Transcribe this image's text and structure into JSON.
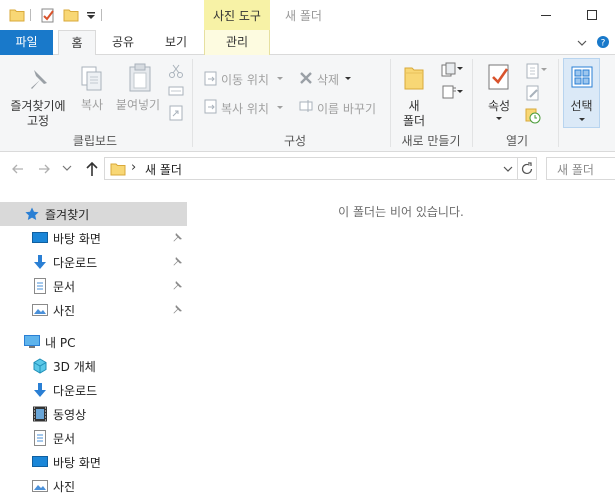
{
  "window": {
    "title": "새 폴더",
    "context_tab_group": "사진 도구"
  },
  "tabs": [
    {
      "label": "파일",
      "active": false
    },
    {
      "label": "홈",
      "active": true
    },
    {
      "label": "공유",
      "active": false
    },
    {
      "label": "보기",
      "active": false
    },
    {
      "label": "관리",
      "active": false
    }
  ],
  "ribbon": {
    "clipboard": {
      "group_label": "클립보드",
      "pin_label_line1": "즐겨찾기에",
      "pin_label_line2": "고정",
      "copy_label": "복사",
      "paste_label": "붙여넣기"
    },
    "organize": {
      "group_label": "구성",
      "move_to": "이동 위치",
      "copy_to": "복사 위치",
      "delete": "삭제",
      "rename": "이름 바꾸기"
    },
    "new": {
      "group_label": "새로 만들기",
      "new_folder_line1": "새",
      "new_folder_line2": "폴더"
    },
    "open": {
      "group_label": "열기",
      "properties": "속성"
    },
    "select": {
      "label": "선택"
    }
  },
  "address": {
    "separator": "›",
    "path": "새 폴더",
    "search_placeholder": "새 폴더"
  },
  "nav": {
    "quick_access": {
      "label": "즐겨찾기",
      "items": [
        {
          "label": "바탕 화면",
          "pinned": true
        },
        {
          "label": "다운로드",
          "pinned": true
        },
        {
          "label": "문서",
          "pinned": true
        },
        {
          "label": "사진",
          "pinned": true
        }
      ]
    },
    "this_pc": {
      "label": "내 PC",
      "items": [
        {
          "label": "3D 개체"
        },
        {
          "label": "다운로드"
        },
        {
          "label": "동영상"
        },
        {
          "label": "문서"
        },
        {
          "label": "바탕 화면"
        },
        {
          "label": "사진"
        }
      ]
    }
  },
  "content": {
    "empty_message": "이 폴더는 비어 있습니다."
  },
  "colors": {
    "file_tab": "#1979ca",
    "context_tab": "#f7f2a6",
    "ribbon_bg": "#f5f6f7",
    "nav_selected": "#d9d9d9",
    "folder_yellow": "#f8d775",
    "accent_blue": "#2a7fd4"
  }
}
